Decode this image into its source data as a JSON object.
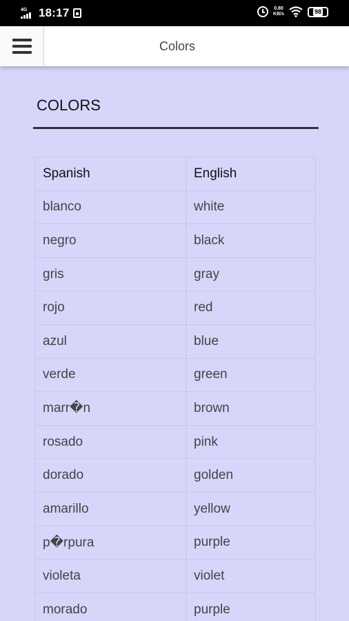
{
  "status_bar": {
    "network": "4G",
    "time": "18:17",
    "speed_value": "0.80",
    "speed_unit": "KB/s",
    "battery": "98"
  },
  "app_bar": {
    "title": "Colors",
    "menu_icon": "hamburger-menu-icon"
  },
  "page": {
    "heading": "COLORS"
  },
  "table": {
    "headers": [
      "Spanish",
      "English"
    ],
    "rows": [
      [
        "blanco",
        "white"
      ],
      [
        "negro",
        "black"
      ],
      [
        "gris",
        "gray"
      ],
      [
        "rojo",
        "red"
      ],
      [
        "azul",
        "blue"
      ],
      [
        "verde",
        "green"
      ],
      [
        "marr�n",
        "brown"
      ],
      [
        "rosado",
        "pink"
      ],
      [
        "dorado",
        "golden"
      ],
      [
        "amarillo",
        "yellow"
      ],
      [
        "p�rpura",
        "purple"
      ],
      [
        "violeta",
        "violet"
      ],
      [
        "morado",
        "purple"
      ]
    ]
  },
  "colors": {
    "page_background": "#d6d6fb",
    "status_bar": "#000000",
    "app_bar": "#ffffff",
    "rule": "#333333"
  }
}
